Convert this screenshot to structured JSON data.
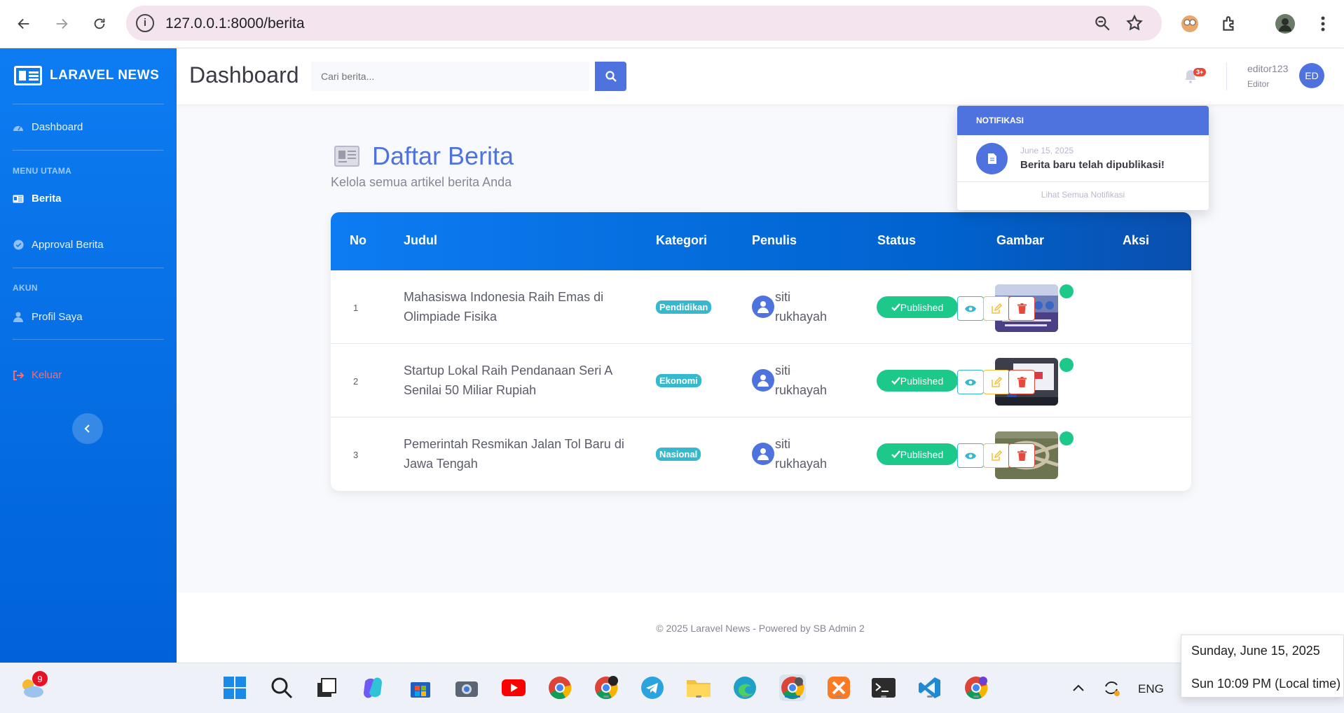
{
  "browser": {
    "url": "127.0.0.1:8000/berita"
  },
  "sidebar": {
    "brand": "LARAVEL NEWS",
    "items": [
      {
        "label": "Dashboard",
        "icon": "gauge-icon"
      },
      {
        "label": "Berita",
        "icon": "newspaper-icon"
      },
      {
        "label": "Approval Berita",
        "icon": "check-circle-icon"
      },
      {
        "label": "Profil Saya",
        "icon": "user-icon"
      },
      {
        "label": "Keluar",
        "icon": "sign-out-icon"
      }
    ],
    "headings": {
      "menu_utama": "MENU UTAMA",
      "akun": "AKUN"
    }
  },
  "topbar": {
    "title": "Dashboard",
    "search_placeholder": "Cari berita...",
    "notification_badge": "3+",
    "user_name": "editor123",
    "user_role": "Editor",
    "user_initials": "ED"
  },
  "main": {
    "title": "Daftar Berita",
    "subtitle": "Kelola semua artikel berita Anda",
    "table": {
      "headers": [
        "No",
        "Judul",
        "Kategori",
        "Penulis",
        "Status",
        "Gambar",
        "Aksi"
      ],
      "rows": [
        {
          "no": "1",
          "title": "Mahasiswa Indonesia Raih Emas di Olimpiade Fisika",
          "category": "Pendidikan",
          "author_line1": "siti",
          "author_line2": "rukhayah",
          "status": "Published"
        },
        {
          "no": "2",
          "title": "Startup Lokal Raih Pendanaan Seri A Senilai 50 Miliar Rupiah",
          "category": "Ekonomi",
          "author_line1": "siti",
          "author_line2": "rukhayah",
          "status": "Published"
        },
        {
          "no": "3",
          "title": "Pemerintah Resmikan Jalan Tol Baru di Jawa Tengah",
          "category": "Nasional",
          "author_line1": "siti",
          "author_line2": "rukhayah",
          "status": "Published"
        }
      ]
    }
  },
  "notifications": {
    "header": "NOTIFIKASI",
    "items": [
      {
        "date": "June 15, 2025",
        "message": "Berita baru telah dipublikasi!"
      }
    ],
    "view_all": "Lihat Semua Notifikasi"
  },
  "footer": {
    "text": "© 2025 Laravel News - Powered by SB Admin 2"
  },
  "taskbar": {
    "weather_badge": "9",
    "language": "ENG",
    "clock_date": "Sunday, June 15, 2025",
    "clock_time": "Sun 10:09 PM (Local time)"
  },
  "colors": {
    "primary": "#4e73df",
    "sidebar": "#0d7cf2",
    "success": "#1cc88a",
    "info": "#36b9cc",
    "danger": "#e74a3b",
    "warning": "#f6c23e"
  }
}
